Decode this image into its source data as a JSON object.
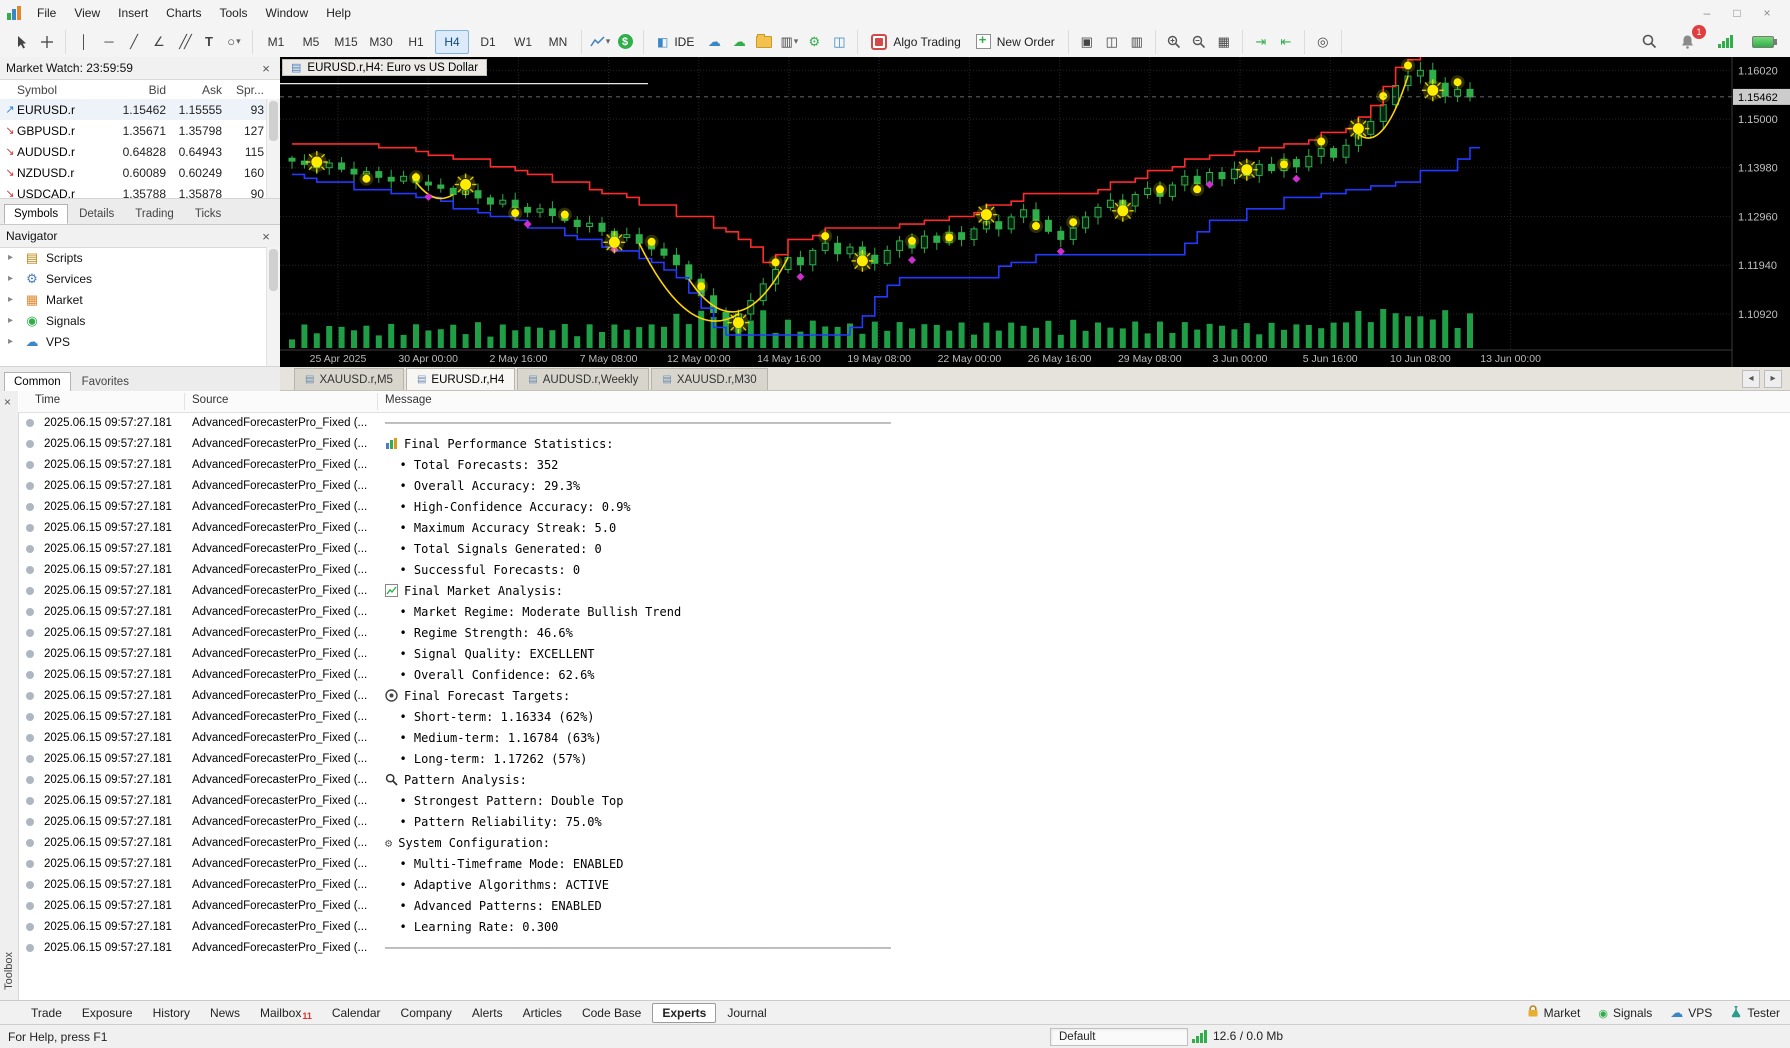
{
  "menubar": {
    "items": [
      "File",
      "View",
      "Insert",
      "Charts",
      "Tools",
      "Window",
      "Help"
    ]
  },
  "toolbar": {
    "timeframes": [
      "M1",
      "M5",
      "M15",
      "M30",
      "H1",
      "H4",
      "D1",
      "W1",
      "MN"
    ],
    "active_timeframe": "H4",
    "ide_label": "IDE",
    "algo_label": "Algo Trading",
    "neworder_label": "New Order",
    "notifications": "1"
  },
  "market_watch": {
    "title": "Market Watch: 23:59:59",
    "columns": [
      "Symbol",
      "Bid",
      "Ask",
      "Spr..."
    ],
    "rows": [
      {
        "symbol": "EURUSD.r",
        "bid": "1.15462",
        "ask": "1.15555",
        "spread": "93",
        "dir": "up",
        "selected": true
      },
      {
        "symbol": "GBPUSD.r",
        "bid": "1.35671",
        "ask": "1.35798",
        "spread": "127",
        "dir": "down"
      },
      {
        "symbol": "AUDUSD.r",
        "bid": "0.64828",
        "ask": "0.64943",
        "spread": "115",
        "dir": "down"
      },
      {
        "symbol": "NZDUSD.r",
        "bid": "0.60089",
        "ask": "0.60249",
        "spread": "160",
        "dir": "down"
      },
      {
        "symbol": "USDCAD.r",
        "bid": "1.35788",
        "ask": "1.35878",
        "spread": "90",
        "dir": "down"
      }
    ],
    "tabs": [
      "Symbols",
      "Details",
      "Trading",
      "Ticks"
    ],
    "active_tab": "Symbols"
  },
  "navigator": {
    "title": "Navigator",
    "items": [
      {
        "label": "Scripts"
      },
      {
        "label": "Services"
      },
      {
        "label": "Market"
      },
      {
        "label": "Signals"
      },
      {
        "label": "VPS"
      }
    ],
    "tabs": [
      "Common",
      "Favorites"
    ],
    "active_tab": "Common"
  },
  "chart": {
    "window_title": "EURUSD.r,H4: Euro vs US Dollar",
    "tabs": [
      "XAUUSD.r,M5",
      "EURUSD.r,H4",
      "AUDUSD.r,Weekly",
      "XAUUSD.r,M30"
    ],
    "active_tab": "EURUSD.r,H4"
  },
  "chart_data": {
    "type": "candlestick",
    "symbol": "EURUSD.r",
    "timeframe": "H4",
    "description": "Euro vs US Dollar",
    "x_labels": [
      "25 Apr 2025",
      "30 Apr 00:00",
      "2 May 16:00",
      "7 May 08:00",
      "12 May 00:00",
      "14 May 16:00",
      "19 May 08:00",
      "22 May 00:00",
      "26 May 16:00",
      "29 May 08:00",
      "3 Jun 00:00",
      "5 Jun 16:00",
      "10 Jun 08:00",
      "13 Jun 00:00"
    ],
    "price_labels": [
      "1.16020",
      "1.15000",
      "1.13980",
      "1.12960",
      "1.11940",
      "1.10920"
    ],
    "current_price": "1.15462",
    "closes": [
      1.1412,
      1.1405,
      1.1398,
      1.1408,
      1.1395,
      1.1385,
      1.139,
      1.1378,
      1.137,
      1.138,
      1.1368,
      1.1362,
      1.1355,
      1.1342,
      1.135,
      1.1335,
      1.1322,
      1.133,
      1.1315,
      1.1305,
      1.1312,
      1.1298,
      1.1288,
      1.1275,
      1.1282,
      1.1265,
      1.1252,
      1.1258,
      1.124,
      1.1228,
      1.1215,
      1.1195,
      1.1165,
      1.113,
      1.1095,
      1.1078,
      1.1092,
      1.112,
      1.1155,
      1.1185,
      1.121,
      1.1195,
      1.1225,
      1.124,
      1.1218,
      1.1232,
      1.1215,
      1.1198,
      1.1225,
      1.1245,
      1.123,
      1.1255,
      1.1242,
      1.1262,
      1.1248,
      1.127,
      1.1285,
      1.127,
      1.1295,
      1.131,
      1.1288,
      1.1265,
      1.1248,
      1.1272,
      1.1295,
      1.1315,
      1.133,
      1.1318,
      1.1342,
      1.1355,
      1.1338,
      1.1362,
      1.138,
      1.1365,
      1.1388,
      1.1375,
      1.1395,
      1.1382,
      1.1405,
      1.1392,
      1.1415,
      1.14,
      1.1422,
      1.1438,
      1.142,
      1.1445,
      1.1468,
      1.1495,
      1.153,
      1.157,
      1.159,
      1.1602,
      1.1575,
      1.1548,
      1.1562,
      1.15462
    ],
    "indicator_params": {
      "red_window": 7,
      "red_offset": 0.0034,
      "blue_window": 10,
      "blue_offset": -0.003
    },
    "sun_markers": [
      {
        "i": 2,
        "d": 0.0012
      },
      {
        "i": 6,
        "d": -0.0015
      },
      {
        "i": 10,
        "d": 0.001
      },
      {
        "i": 14,
        "d": 0.0013
      },
      {
        "i": 18,
        "d": -0.0012
      },
      {
        "i": 22,
        "d": 0.0012
      },
      {
        "i": 26,
        "d": -0.001
      },
      {
        "i": 29,
        "d": 0.0015
      },
      {
        "i": 33,
        "d": 0.002
      },
      {
        "i": 36,
        "d": -0.0018
      },
      {
        "i": 39,
        "d": 0.0015
      },
      {
        "i": 43,
        "d": 0.0015
      },
      {
        "i": 46,
        "d": -0.0012
      },
      {
        "i": 50,
        "d": 0.0015
      },
      {
        "i": 53,
        "d": -0.001
      },
      {
        "i": 56,
        "d": 0.0015
      },
      {
        "i": 60,
        "d": -0.0012
      },
      {
        "i": 63,
        "d": 0.0012
      },
      {
        "i": 67,
        "d": -0.001
      },
      {
        "i": 70,
        "d": 0.0015
      },
      {
        "i": 73,
        "d": -0.0012
      },
      {
        "i": 77,
        "d": 0.0012
      },
      {
        "i": 80,
        "d": -0.001
      },
      {
        "i": 83,
        "d": 0.0015
      },
      {
        "i": 86,
        "d": 0.0012
      },
      {
        "i": 88,
        "d": 0.0018
      },
      {
        "i": 90,
        "d": 0.0022
      },
      {
        "i": 92,
        "d": -0.0015
      },
      {
        "i": 94,
        "d": 0.0015
      }
    ],
    "diamond_markers": [
      11,
      19,
      26,
      41,
      50,
      62,
      74,
      81
    ],
    "arcs": [
      {
        "a": 10,
        "b": 13,
        "d": 0.0025
      },
      {
        "a": 28,
        "b": 36,
        "d": 0.005
      },
      {
        "a": 32,
        "b": 40,
        "d": 0.007
      },
      {
        "a": 86,
        "b": 90,
        "d": 0.004
      }
    ]
  },
  "toolbox": {
    "columns": [
      "Time",
      "Source",
      "Message"
    ],
    "time": "2025.06.15 09:57:27.181",
    "source": "AdvancedForecasterPro_Fixed (...",
    "separator": "──────────────────────────────────────────────────────────────────────",
    "rows": [
      {
        "type": "sep"
      },
      {
        "icon": "stats",
        "msg": "Final Performance Statistics:"
      },
      {
        "msg": "  • Total Forecasts: 352"
      },
      {
        "msg": "  • Overall Accuracy: 29.3%"
      },
      {
        "msg": "  • High-Confidence Accuracy: 0.9%"
      },
      {
        "msg": "  • Maximum Accuracy Streak: 5.0"
      },
      {
        "msg": "  • Total Signals Generated: 0"
      },
      {
        "msg": "  • Successful Forecasts: 0"
      },
      {
        "icon": "chart",
        "msg": "Final Market Analysis:"
      },
      {
        "msg": "  • Market Regime: Moderate Bullish Trend"
      },
      {
        "msg": "  • Regime Strength: 46.6%"
      },
      {
        "msg": "  • Signal Quality: EXCELLENT"
      },
      {
        "msg": "  • Overall Confidence: 62.6%"
      },
      {
        "icon": "target",
        "msg": "Final Forecast Targets:"
      },
      {
        "msg": "  • Short-term: 1.16334 (62%)"
      },
      {
        "msg": "  • Medium-term: 1.16784 (63%)"
      },
      {
        "msg": "  • Long-term: 1.17262 (57%)"
      },
      {
        "icon": "search",
        "msg": "Pattern Analysis:"
      },
      {
        "msg": "  • Strongest Pattern: Double Top"
      },
      {
        "msg": "  • Pattern Reliability: 75.0%"
      },
      {
        "icon": "gear",
        "msg": "System Configuration:"
      },
      {
        "msg": "  • Multi-Timeframe Mode: ENABLED"
      },
      {
        "msg": "  • Adaptive Algorithms: ACTIVE"
      },
      {
        "msg": "  • Advanced Patterns: ENABLED"
      },
      {
        "msg": "  • Learning Rate: 0.300"
      },
      {
        "type": "sep"
      }
    ],
    "tabs": [
      "Trade",
      "Exposure",
      "History",
      "News",
      {
        "label": "Mailbox",
        "badge": "11"
      },
      "Calendar",
      "Company",
      "Alerts",
      "Articles",
      "Code Base",
      "Experts",
      "Journal"
    ],
    "active_tab": "Experts",
    "quick_access": [
      {
        "label": "Market",
        "icon": "lock-icon"
      },
      {
        "label": "Signals",
        "icon": "signal-icon"
      },
      {
        "label": "VPS",
        "icon": "cloud-icon"
      },
      {
        "label": "Tester",
        "icon": "flask-icon"
      }
    ]
  },
  "statusbar": {
    "help": "For Help, press F1",
    "profile": "Default",
    "traffic": "12.6 / 0.0 Mb"
  }
}
